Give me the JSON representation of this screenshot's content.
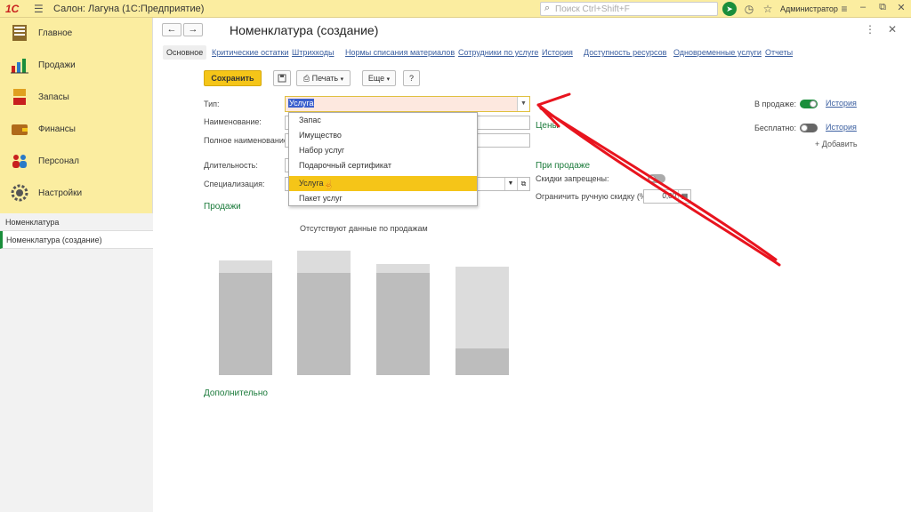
{
  "titlebar": {
    "logo": "1С",
    "title": "Салон: Лагуна  (1С:Предприятие)",
    "search_placeholder": "Поиск Ctrl+Shift+F",
    "user": "Администратор"
  },
  "sidebar": {
    "items": [
      {
        "label": "Главное",
        "icon": "home-icon"
      },
      {
        "label": "Продажи",
        "icon": "sales-chart-icon"
      },
      {
        "label": "Запасы",
        "icon": "inventory-icon"
      },
      {
        "label": "Финансы",
        "icon": "wallet-icon"
      },
      {
        "label": "Персонал",
        "icon": "people-icon"
      },
      {
        "label": "Настройки",
        "icon": "gear-icon"
      }
    ],
    "open_windows_header": "Номенклатура",
    "open_windows": [
      "Номенклатура (создание)"
    ]
  },
  "main": {
    "title": "Номенклатура (создание)",
    "tabs": [
      "Основное",
      "Критические остатки",
      "Штрихкоды",
      "Нормы списания материалов",
      "Сотрудники по услуге",
      "История",
      "Доступность ресурсов",
      "Одновременные услуги",
      "Отчеты"
    ],
    "toolbar": {
      "save": "Сохранить",
      "print": "Печать",
      "more": "Еще",
      "help": "?"
    },
    "form": {
      "type_label": "Тип:",
      "type_value": "Услуга",
      "name_label": "Наименование:",
      "full_name_label": "Полное наименование:",
      "duration_label": "Длительность:",
      "specialization_label": "Специализация:"
    },
    "type_options": [
      "Запас",
      "Имущество",
      "Набор услуг",
      "Подарочный сертификат",
      "Услуга",
      "Пакет услуг"
    ],
    "highlighted_option": "Услуга",
    "sales_section": "Продажи",
    "chart_caption": "Отсутствуют данные по продажам",
    "extra_section": "Дополнительно",
    "right": {
      "prices_section": "Цены",
      "on_sale_label": "В продаже:",
      "free_label": "Бесплатно:",
      "history_link": "История",
      "add_link": "+ Добавить",
      "at_sale_section": "При продаже",
      "discounts_forbidden": "Скидки запрещены:",
      "limit_manual_discount": "Ограничить ручную скидку (%):",
      "manual_discount_value": "0,00"
    }
  },
  "colors": {
    "accent_yellow": "#f5c518",
    "sidebar_bg": "#fbeda0",
    "green": "#1a8e3b",
    "link_blue": "#3b5fa0",
    "annotation_red": "#e8141e"
  },
  "placeholder_chart": {
    "bars": [
      {
        "total": 0.78,
        "filled": 0.7
      },
      {
        "total": 0.85,
        "filled": 0.7
      },
      {
        "total": 0.76,
        "filled": 0.7
      },
      {
        "total": 0.74,
        "filled": 0.18
      }
    ]
  }
}
